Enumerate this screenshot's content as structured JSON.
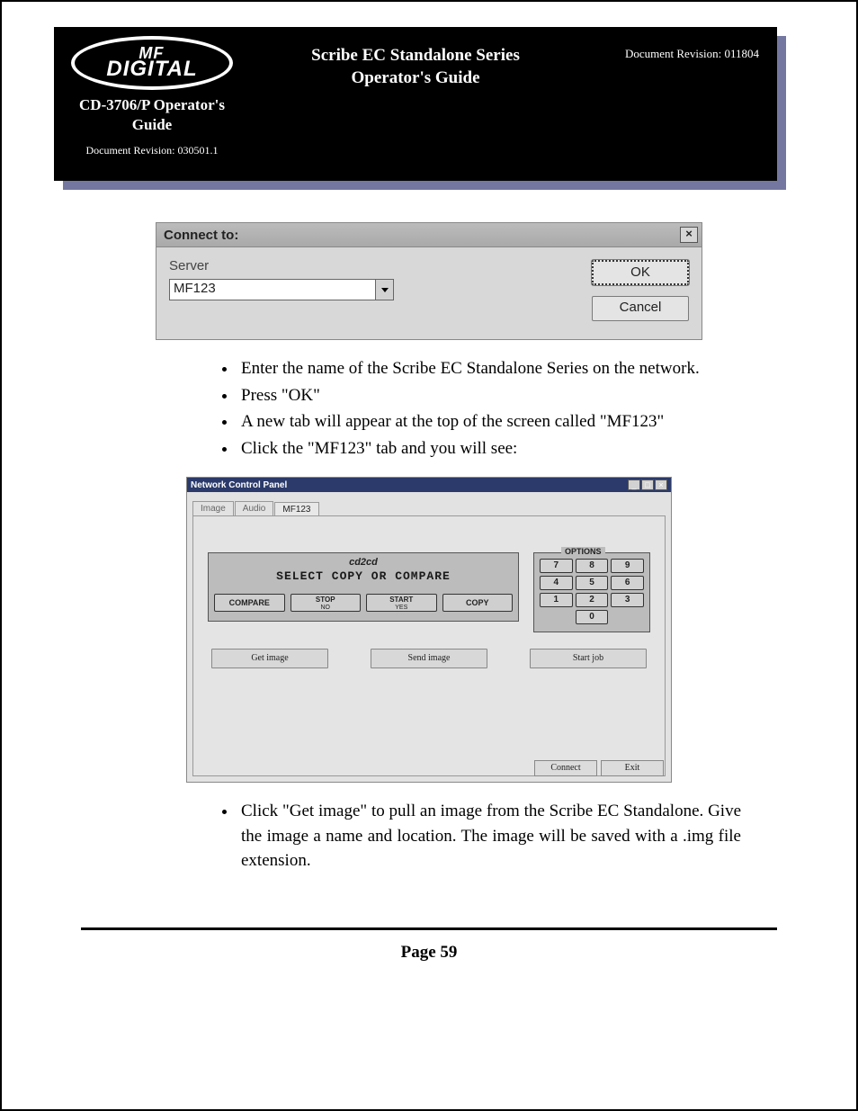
{
  "header": {
    "logo_top": "MF",
    "logo_main": "DIGITAL",
    "logo_subtitle_1": "CD-3706/P Operator's",
    "logo_subtitle_2": "Guide",
    "logo_rev": "Document Revision: 030501.1",
    "center_1": "Scribe EC Standalone Series",
    "center_2": "Operator's Guide",
    "right": "Document Revision: 011804"
  },
  "connect_dialog": {
    "title": "Connect to:",
    "close": "×",
    "label": "Server",
    "value": "MF123",
    "ok": "OK",
    "cancel": "Cancel"
  },
  "bullets_a": [
    "Enter the name of the Scribe EC Standalone Series on the network.",
    "Press \"OK\"",
    "A new tab will appear at the top of the screen called \"MF123\"",
    "Click the \"MF123\" tab and you will see:"
  ],
  "ncp": {
    "title": "Network Control Panel",
    "win_min": "_",
    "win_max": "□",
    "win_close": "×",
    "tabs": [
      "Image",
      "Audio",
      "MF123"
    ],
    "cd_head": "cd2cd",
    "cd_msg": "SELECT COPY OR COMPARE",
    "compare": "COMPARE",
    "stop_top": "STOP",
    "stop_sub": "NO",
    "start_top": "START",
    "start_sub": "YES",
    "copy": "COPY",
    "options_title": "OPTIONS",
    "keys": [
      "7",
      "8",
      "9",
      "4",
      "5",
      "6",
      "1",
      "2",
      "3",
      "0"
    ],
    "get_image": "Get image",
    "send_image": "Send image",
    "start_job": "Start job",
    "connect": "Connect",
    "exit": "Exit"
  },
  "bullets_b": [
    "Click \"Get image\" to pull an image from the Scribe EC Standalone. Give the image a name and location. The image will be saved with a .img file extension."
  ],
  "page_num": "Page 59"
}
